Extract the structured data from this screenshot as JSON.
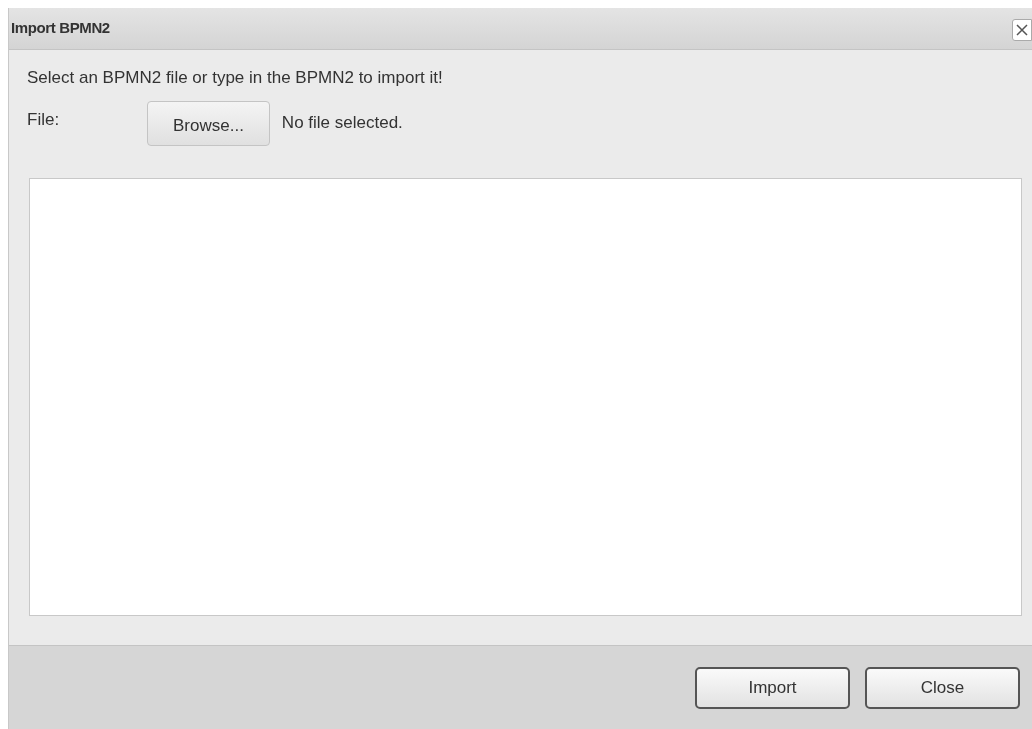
{
  "window": {
    "title": "Import BPMN2"
  },
  "instructions": "Select an BPMN2 file or type in the BPMN2 to import it!",
  "file": {
    "label": "File:",
    "button": "Browse...",
    "status": "No file selected."
  },
  "buttons": [
    "Import",
    "Close"
  ]
}
